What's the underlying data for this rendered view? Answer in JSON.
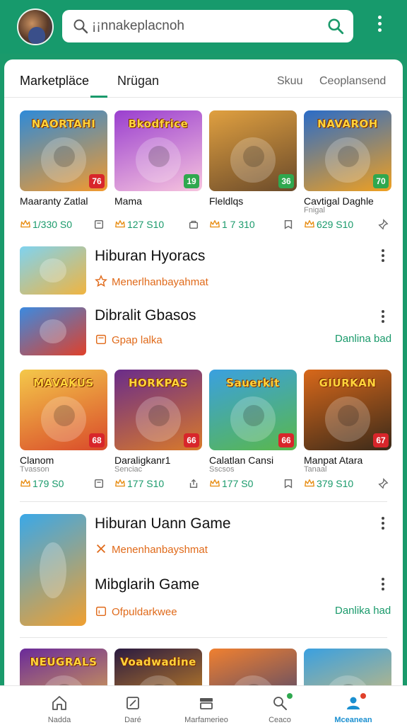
{
  "search": {
    "value": "¡¡nnakeplacnoh"
  },
  "tabs": {
    "marketplace": "Marketpläce",
    "second": "Nrügan",
    "right1": "Skuu",
    "right2": "Ceoplansend"
  },
  "grid1": [
    {
      "title": "NAORTAHI",
      "badge": "76",
      "badge_color": "#d8262b",
      "name": "Maaranty Zatlal",
      "sub": "",
      "price": "1/330 S0",
      "bg": [
        "#2e8ad8",
        "#f29a2e"
      ],
      "action_icon": "square-icon"
    },
    {
      "title": "Bkodfrice",
      "badge": "19",
      "badge_color": "#2fa84f",
      "name": "Mama",
      "sub": "",
      "price": "127 S10",
      "bg": [
        "#9a3fcf",
        "#f7c4de"
      ],
      "action_icon": "bag-icon"
    },
    {
      "title": "",
      "badge": "36",
      "badge_color": "#2fa84f",
      "name": "Fleldlqs",
      "sub": "",
      "price": "1 7 310",
      "bg": [
        "#e0a040",
        "#6a4a2a"
      ],
      "action_icon": "bookmark-icon"
    },
    {
      "title": "NAVAROH",
      "badge": "70",
      "badge_color": "#2fa84f",
      "name": "Cavtigal Daghle",
      "sub": "Fnigal",
      "price": "629 S10",
      "bg": [
        "#2a6cc8",
        "#f0a020"
      ],
      "action_icon": "pin-icon"
    }
  ],
  "list1": [
    {
      "title": "Hiburan Hyoracs",
      "sub": "Menerlhanbayahmat",
      "sub_color": "#e06a1a",
      "action": "",
      "bg": [
        "#7fd3f0",
        "#f0b440"
      ],
      "sub_icon": "star-icon"
    },
    {
      "title": "Dibralit Gbasos",
      "sub": "Gpap lalka",
      "sub_color": "#e06a1a",
      "action": "Danlina bad",
      "bg": [
        "#3b8ae0",
        "#e0402a"
      ],
      "sub_icon": "calendar-icon"
    }
  ],
  "grid2": [
    {
      "title": "MAVAKUS",
      "badge": "68",
      "badge_color": "#d8262b",
      "name": "Clanom",
      "sub": "Tvasson",
      "price": "179 S0",
      "bg": [
        "#f4c84a",
        "#d94a2a"
      ],
      "action_icon": "square-icon"
    },
    {
      "title": "HORKPAS",
      "badge": "66",
      "badge_color": "#d8262b",
      "name": "Daraligkanr1",
      "sub": "Senciac",
      "price": "177 S10",
      "bg": [
        "#6a2c8a",
        "#d97a2a"
      ],
      "action_icon": "share-icon"
    },
    {
      "title": "Sauerkit",
      "badge": "66",
      "badge_color": "#d8262b",
      "name": "Calatlan Cansi",
      "sub": "Sscsos",
      "price": "177 S0",
      "bg": [
        "#3aa0e0",
        "#5ab84a"
      ],
      "action_icon": "bookmark-icon"
    },
    {
      "title": "GIURKAN",
      "badge": "67",
      "badge_color": "#d8262b",
      "name": "Manpat Atara",
      "sub": "Tanaal",
      "price": "379 S10",
      "bg": [
        "#d8681a",
        "#3a2a1a"
      ],
      "action_icon": "pin-icon"
    }
  ],
  "feature": {
    "title1": "Hiburan Uann Game",
    "sub1": "Menenhanbayshmat",
    "title2": "Mibglarih Game",
    "sub2": "Ofpuldarkwee",
    "action": "Danlika had"
  },
  "grid3": [
    {
      "title": "NEUGRALS",
      "bg": [
        "#6a2a9a",
        "#f0c040"
      ]
    },
    {
      "title": "Voadwadine",
      "bg": [
        "#2a1a40",
        "#f0a020"
      ]
    },
    {
      "title": "",
      "bg": [
        "#f08030",
        "#2a3a7a"
      ]
    },
    {
      "title": "",
      "bg": [
        "#3aa0e0",
        "#f0c060"
      ]
    }
  ],
  "nav": [
    {
      "label": "Nadda",
      "icon": "home-icon",
      "active": false
    },
    {
      "label": "Daré",
      "icon": "edit-icon",
      "active": false
    },
    {
      "label": "Marfamerieo",
      "icon": "store-icon",
      "active": false
    },
    {
      "label": "Ceaco",
      "icon": "search-icon",
      "active": false
    },
    {
      "label": "Mceanean",
      "icon": "profile-icon",
      "active": true
    }
  ],
  "colors": {
    "accent": "#1a9a6b",
    "header": "#179a6c",
    "active_nav": "#1a8fd0"
  }
}
